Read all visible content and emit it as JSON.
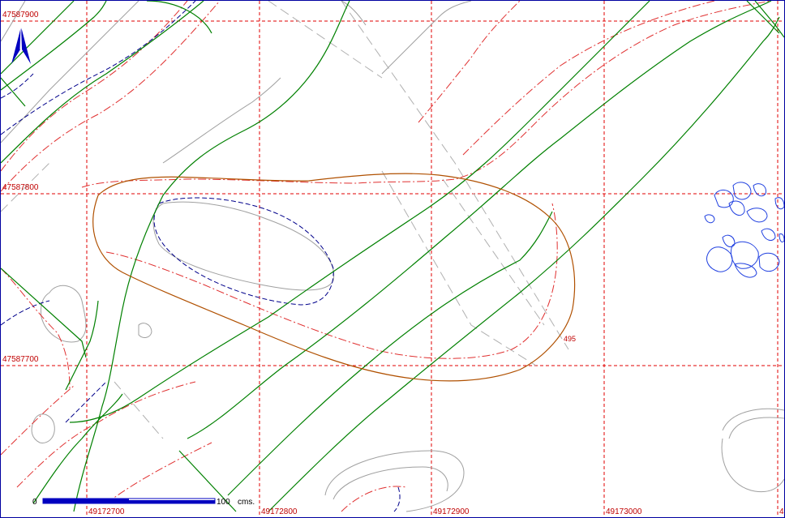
{
  "map": {
    "grid_color": "#e00000",
    "grid_lines_x": [
      "49172700",
      "49172800",
      "49172900",
      "49173000"
    ],
    "grid_lines_y": [
      "47587900",
      "47587800",
      "47587700"
    ],
    "contour_label": "495",
    "colors": {
      "contour_green": "#008000",
      "contour_red": "#e03030",
      "boundary_brown": "#b05000",
      "path_blue": "#00008b",
      "pond_blue": "#2040e0",
      "road_gray": "#a0a0a0"
    }
  },
  "scale_bar": {
    "start_label": "0",
    "end_label": "100",
    "unit_label": "cms."
  },
  "north_arrow": {
    "icon": "north-arrow-icon"
  }
}
